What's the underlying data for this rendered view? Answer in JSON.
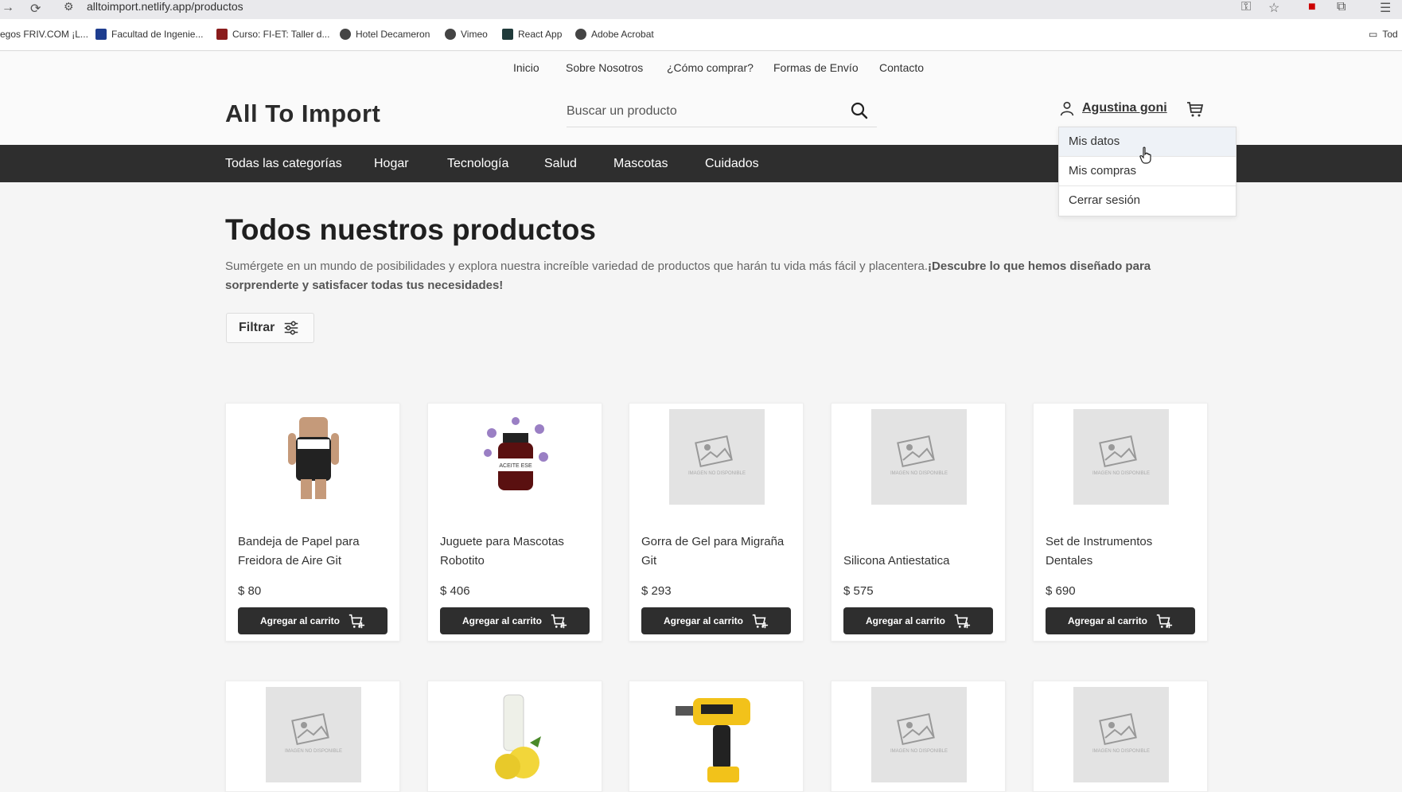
{
  "browser": {
    "url": "alltoimport.netlify.app/productos",
    "bookmarks": [
      "egos FRIV.COM ¡L...",
      "Facultad de Ingenie...",
      "Curso: FI-ET: Taller d...",
      "Hotel Decameron",
      "Vimeo",
      "React App",
      "Adobe Acrobat",
      "Tod"
    ]
  },
  "topnav": [
    "Inicio",
    "Sobre Nosotros",
    "¿Cómo comprar?",
    "Formas de Envío",
    "Contacto"
  ],
  "header": {
    "logo": "All To Import",
    "search_placeholder": "Buscar un producto",
    "user_name": "Agustina goni"
  },
  "categories": [
    "Todas las categorías",
    "Hogar",
    "Tecnología",
    "Salud",
    "Mascotas",
    "Cuidados"
  ],
  "user_menu": [
    "Mis datos",
    "Mis compras",
    "Cerrar sesión"
  ],
  "main": {
    "title": "Todos nuestros productos",
    "desc_normal": "Sumérgete en un mundo de posibilidades y explora nuestra increíble variedad de productos que harán tu vida más fácil y placentera.",
    "desc_bold": "¡Descubre lo que hemos diseñado para sorprenderte y satisfacer todas tus necesidades!",
    "filter_label": "Filtrar",
    "add_to_cart_label": "Agregar al carrito"
  },
  "products": [
    {
      "name": "Bandeja de Papel para Freidora de Aire Git",
      "price": "$ 80",
      "image": "girdle-photo"
    },
    {
      "name": "Juguete para Mascotas Robotito",
      "price": "$ 406",
      "image": "aceite-bottle-photo"
    },
    {
      "name": "Gorra de Gel para Migraña Git",
      "price": "$ 293",
      "image": "no-image"
    },
    {
      "name": "Silicona Antiestatica",
      "price": "$ 575",
      "image": "no-image"
    },
    {
      "name": "Set de Instrumentos Dentales",
      "price": "$ 690",
      "image": "no-image"
    }
  ],
  "products_row2": [
    "no-image",
    "lemon-bottle-photo",
    "drill-photo",
    "no-image",
    "no-image"
  ],
  "placeholder_text": "IMAGEN NO DISPONIBLE"
}
